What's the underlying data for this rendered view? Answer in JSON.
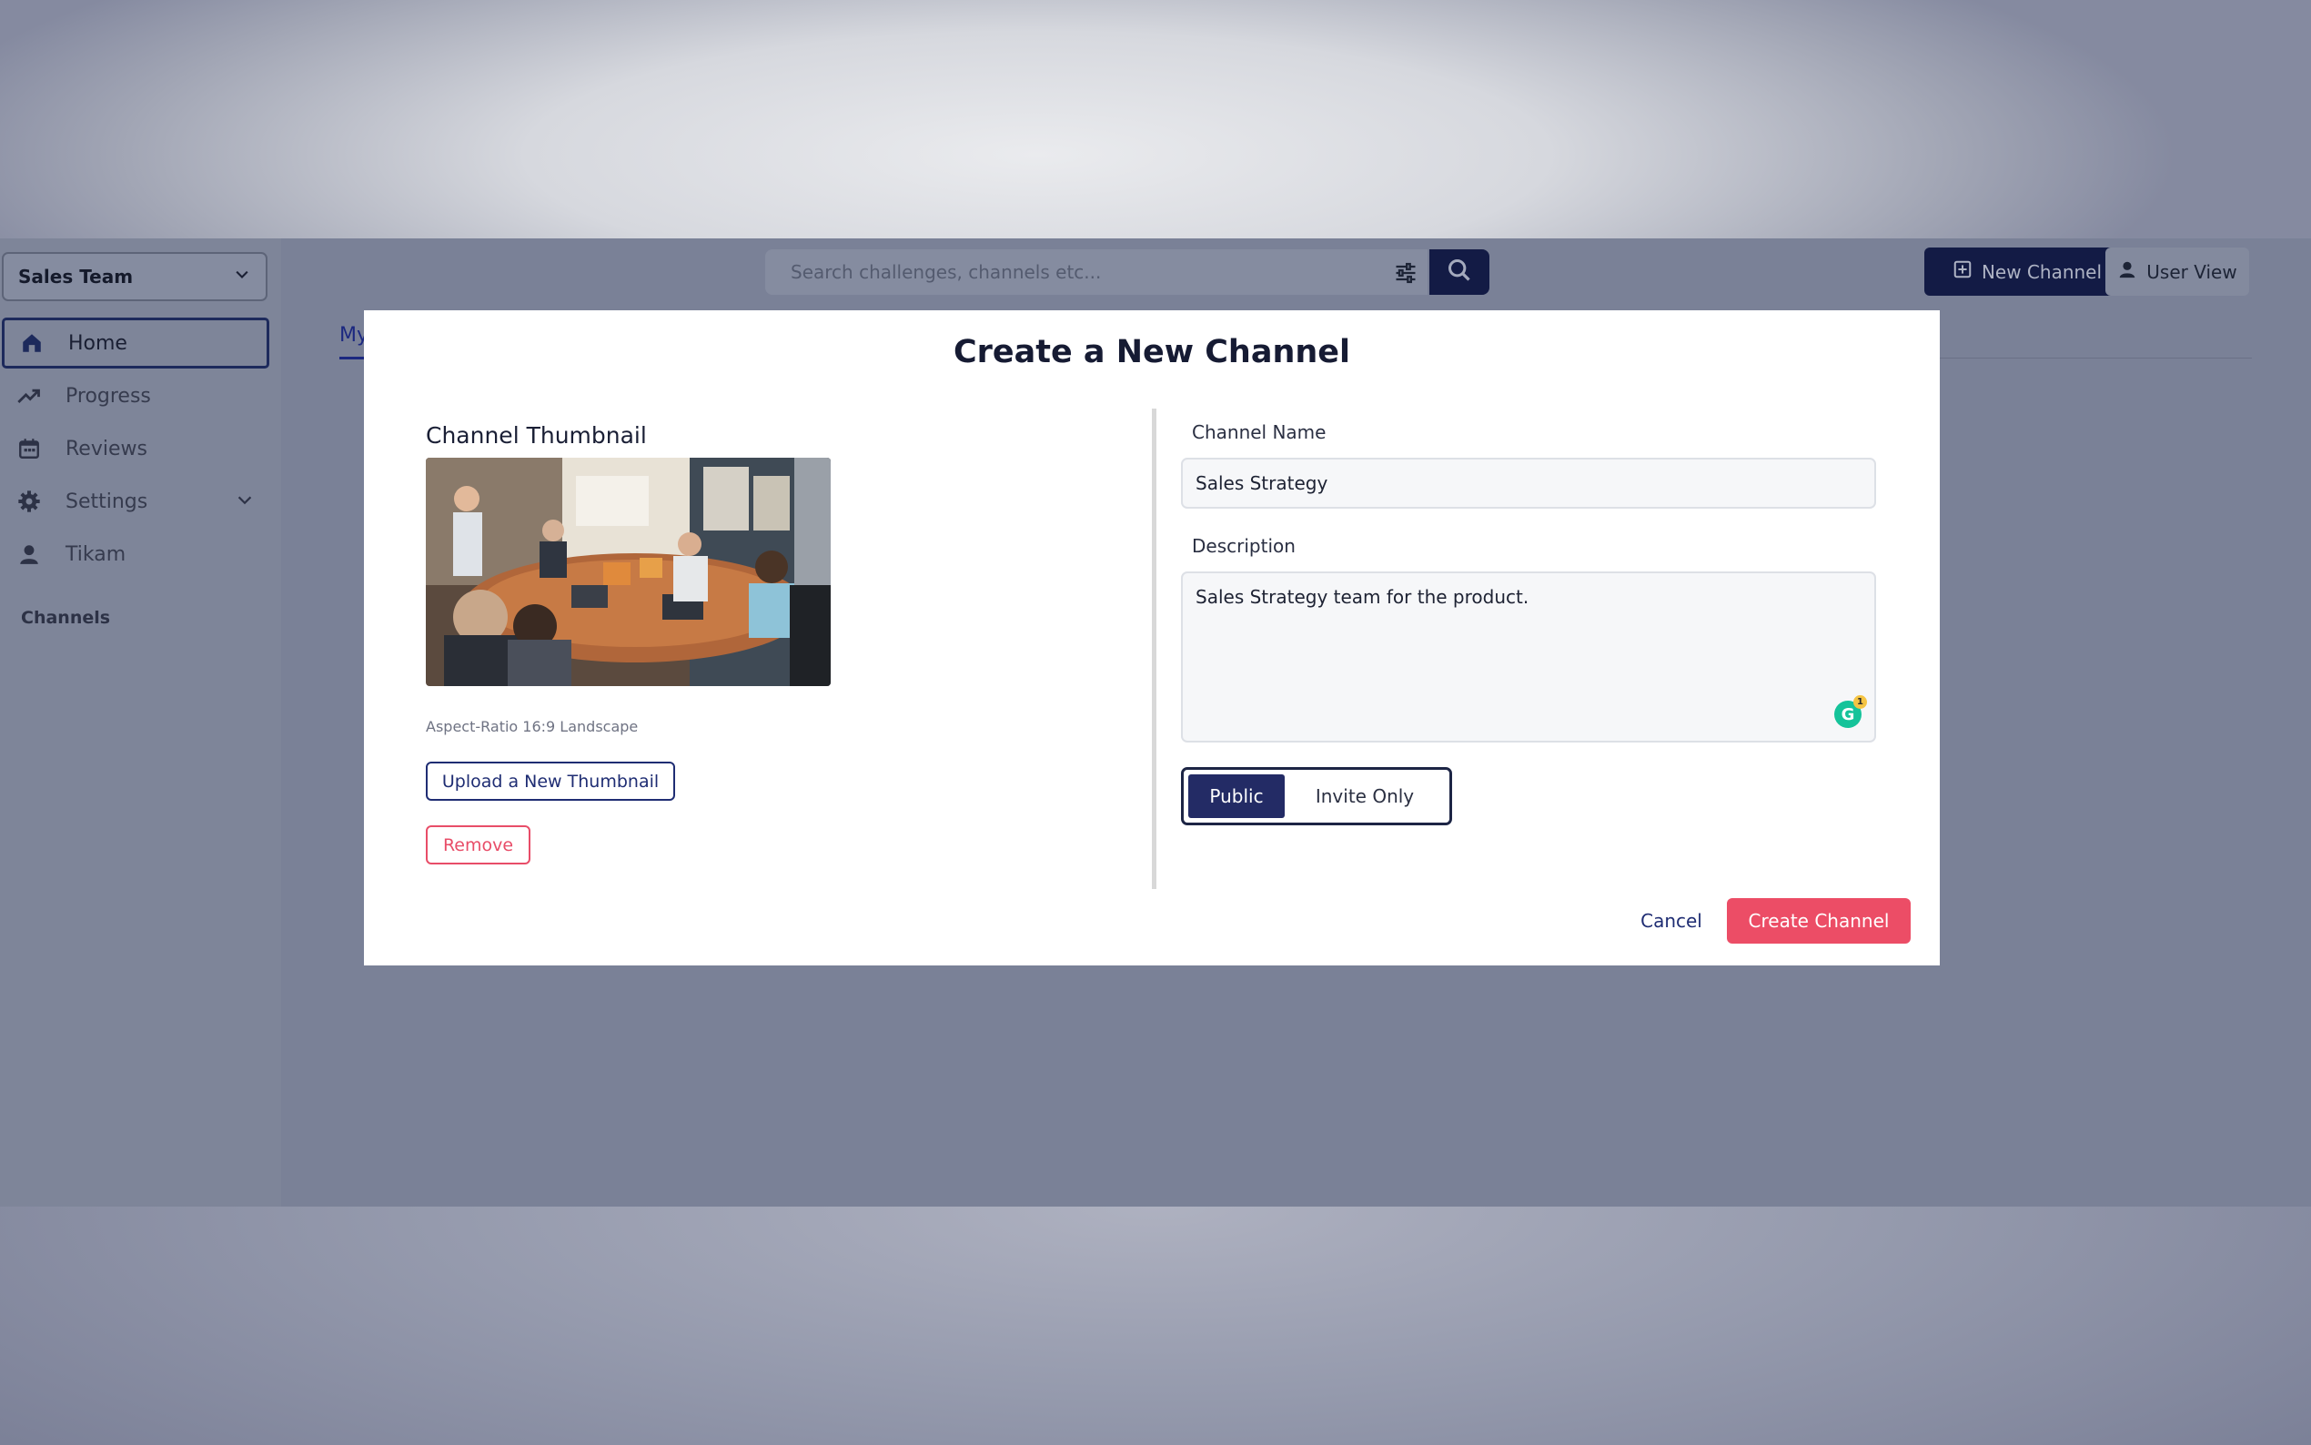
{
  "sidebar": {
    "team": "Sales Team",
    "items": [
      {
        "label": "Home",
        "icon": "home-icon",
        "active": true
      },
      {
        "label": "Progress",
        "icon": "trending-up-icon"
      },
      {
        "label": "Reviews",
        "icon": "calendar-icon"
      },
      {
        "label": "Settings",
        "icon": "gear-icon"
      },
      {
        "label": "Tikam",
        "icon": "person-icon"
      }
    ],
    "channels_label": "Channels"
  },
  "header": {
    "search_placeholder": "Search challenges, channels etc...",
    "new_channel_label": "New Channel",
    "user_view_label": "User View"
  },
  "tabs": {
    "visible_fragment": "My"
  },
  "modal": {
    "title": "Create a New Channel",
    "thumbnail_heading": "Channel Thumbnail",
    "aspect_note": "Aspect-Ratio 16:9 Landscape",
    "upload_label": "Upload a New Thumbnail",
    "remove_label": "Remove",
    "name_label": "Channel Name",
    "name_value": "Sales Strategy",
    "description_label": "Description",
    "description_value": "Sales Strategy team for the product.",
    "grammarly_count": "1",
    "visibility_options": [
      "Public",
      "Invite Only"
    ],
    "visibility_selected": "Public",
    "cancel_label": "Cancel",
    "create_label": "Create Channel"
  },
  "colors": {
    "primary": "#131b45",
    "accent": "#ec4d66",
    "overlay": "#7a8197"
  }
}
